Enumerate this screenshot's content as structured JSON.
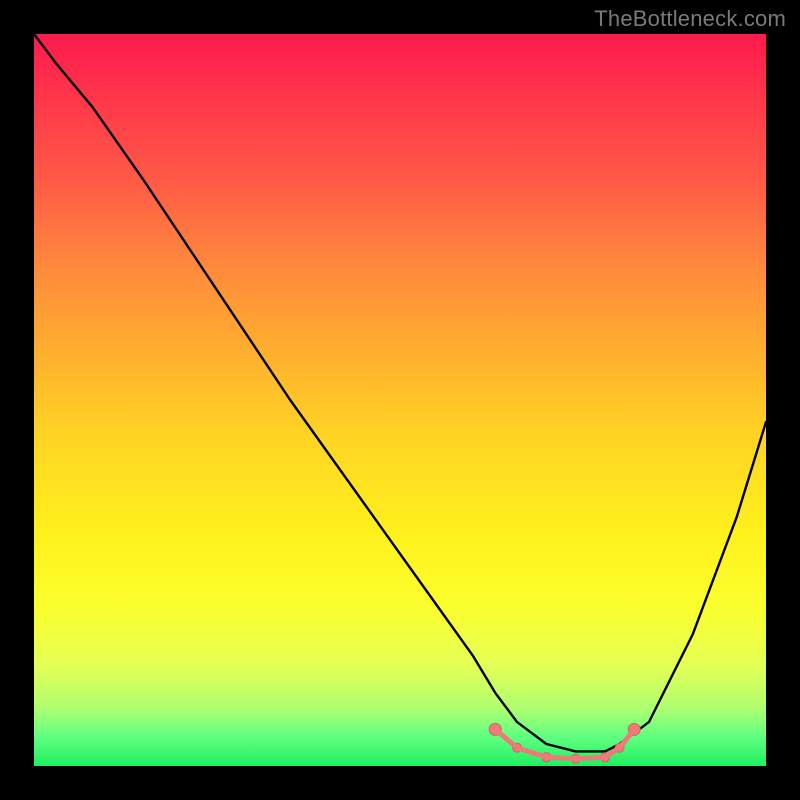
{
  "watermark": "TheBottleneck.com",
  "chart_data": {
    "type": "line",
    "title": "",
    "xlabel": "",
    "ylabel": "",
    "xlim": [
      0,
      100
    ],
    "ylim": [
      0,
      100
    ],
    "grid": false,
    "series": [
      {
        "name": "bottleneck-curve",
        "x": [
          0,
          3,
          8,
          15,
          25,
          35,
          45,
          55,
          60,
          63,
          66,
          70,
          74,
          78,
          80,
          84,
          90,
          96,
          100
        ],
        "values": [
          100,
          96,
          90,
          80,
          65,
          50,
          36,
          22,
          15,
          10,
          6,
          3,
          2,
          2,
          3,
          6,
          18,
          34,
          47
        ]
      }
    ],
    "optimal_zone": {
      "x": [
        63,
        66,
        70,
        74,
        78,
        80,
        82
      ],
      "values": [
        5,
        2.5,
        1.2,
        1,
        1.2,
        2.5,
        5
      ]
    },
    "colors": {
      "curve": "#000000",
      "markers": "#ef7a7a",
      "marker_stroke": "#d46060"
    }
  }
}
